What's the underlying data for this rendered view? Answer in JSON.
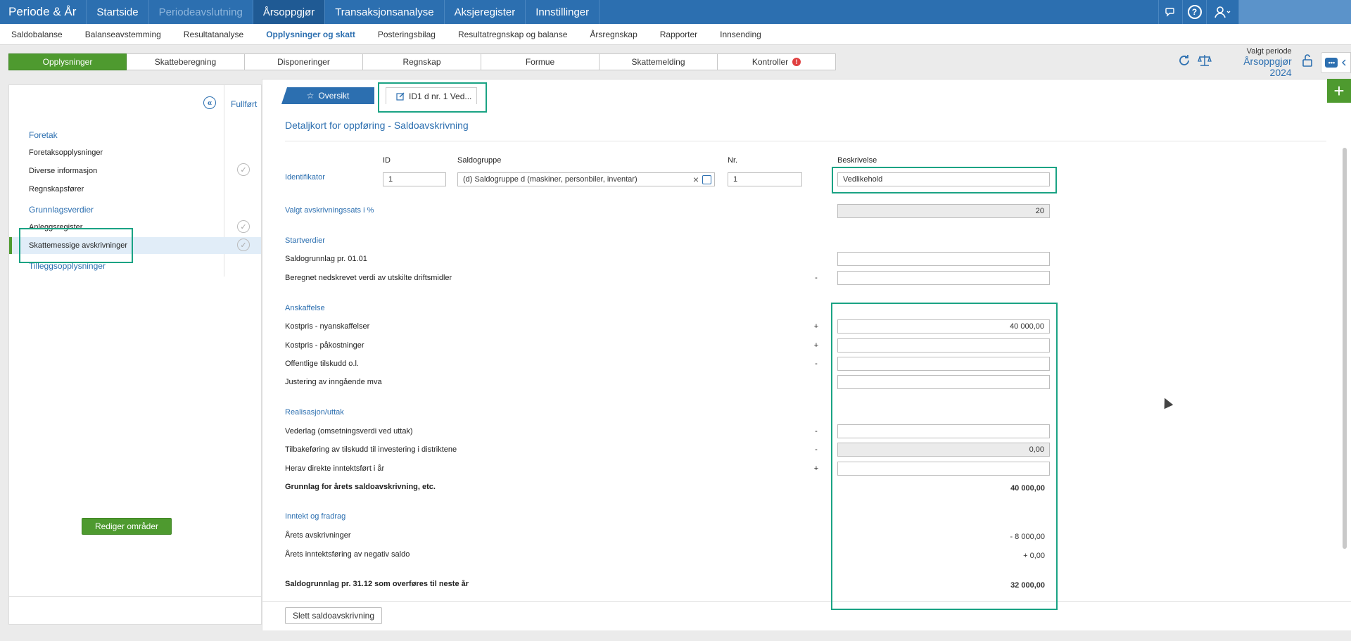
{
  "topnav": {
    "brand": "Periode & År",
    "items": [
      "Startside",
      "Periodeavslutning",
      "Årsoppgjør",
      "Transaksjonsanalyse",
      "Aksjeregister",
      "Innstillinger"
    ]
  },
  "subnav": [
    "Saldobalanse",
    "Balanseavstemming",
    "Resultatanalyse",
    "Opplysninger og skatt",
    "Posteringsbilag",
    "Resultatregnskap og balanse",
    "Årsregnskap",
    "Rapporter",
    "Innsending"
  ],
  "tabs": [
    "Opplysninger",
    "Skatteberegning",
    "Disponeringer",
    "Regnskap",
    "Formue",
    "Skattemelding",
    "Kontroller"
  ],
  "kontroller_badge": "!",
  "period": {
    "label": "Valgt periode",
    "value": "Årsoppgjør 2024"
  },
  "left": {
    "fullfort": "Fullført",
    "sections": [
      {
        "title": "Foretak",
        "items": [
          "Foretaksopplysninger",
          "Diverse informasjon",
          "Regnskapsfører"
        ]
      },
      {
        "title": "Grunnlagsverdier",
        "items": [
          "Anleggsregister",
          "Skattemessige avskrivninger"
        ]
      },
      {
        "title": "Tilleggsopplysninger",
        "items": []
      }
    ],
    "button": "Rediger områder"
  },
  "detail_tabs": {
    "overview": "Oversikt",
    "current": "ID1 d nr. 1 Ved..."
  },
  "title": "Detaljkort for oppføring - Saldoavskrivning",
  "cols": {
    "id": "ID",
    "saldogruppe": "Saldogruppe",
    "nr": "Nr.",
    "beskrivelse": "Beskrivelse"
  },
  "identifikator": {
    "label": "Identifikator",
    "id": "1",
    "saldogruppe": "(d) Saldogruppe d (maskiner, personbiler, inventar)",
    "nr": "1",
    "beskrivelse": "Vedlikehold"
  },
  "sats": {
    "label": "Valgt avskrivningssats i %",
    "value": "20"
  },
  "start": {
    "title": "Startverdier",
    "saldogrunnlag": "Saldogrunnlag pr. 01.01",
    "beregnet": "Beregnet nedskrevet verdi av utskilte driftsmidler"
  },
  "anskaffelse": {
    "title": "Anskaffelse",
    "kostpris_ny": "Kostpris - nyanskaffelser",
    "kostpris_ny_val": "40 000,00",
    "kostpris_pa": "Kostpris - påkostninger",
    "tilskudd": "Offentlige tilskudd o.l.",
    "mva": "Justering av inngående mva"
  },
  "realisasjon": {
    "title": "Realisasjon/uttak",
    "vederlag": "Vederlag (omsetningsverdi ved uttak)",
    "tilbake": "Tilbakeføring av tilskudd til investering i distriktene",
    "tilbake_val": "0,00",
    "herav": "Herav direkte inntektsført i år",
    "grunnlag": "Grunnlag for årets saldoavskrivning, etc.",
    "grunnlag_val": "40 000,00"
  },
  "inntekt": {
    "title": "Inntekt og fradrag",
    "avskr": "Årets avskrivninger",
    "avskr_val": "- 8 000,00",
    "neg": "Årets inntektsføring av negativ saldo",
    "neg_val": "+ 0,00"
  },
  "saldo_neste": {
    "label": "Saldogrunnlag pr. 31.12 som overføres til neste år",
    "value": "32 000,00"
  },
  "delete_button": "Slett saldoavskrivning",
  "signs": {
    "minus": "-",
    "plus": "+"
  }
}
